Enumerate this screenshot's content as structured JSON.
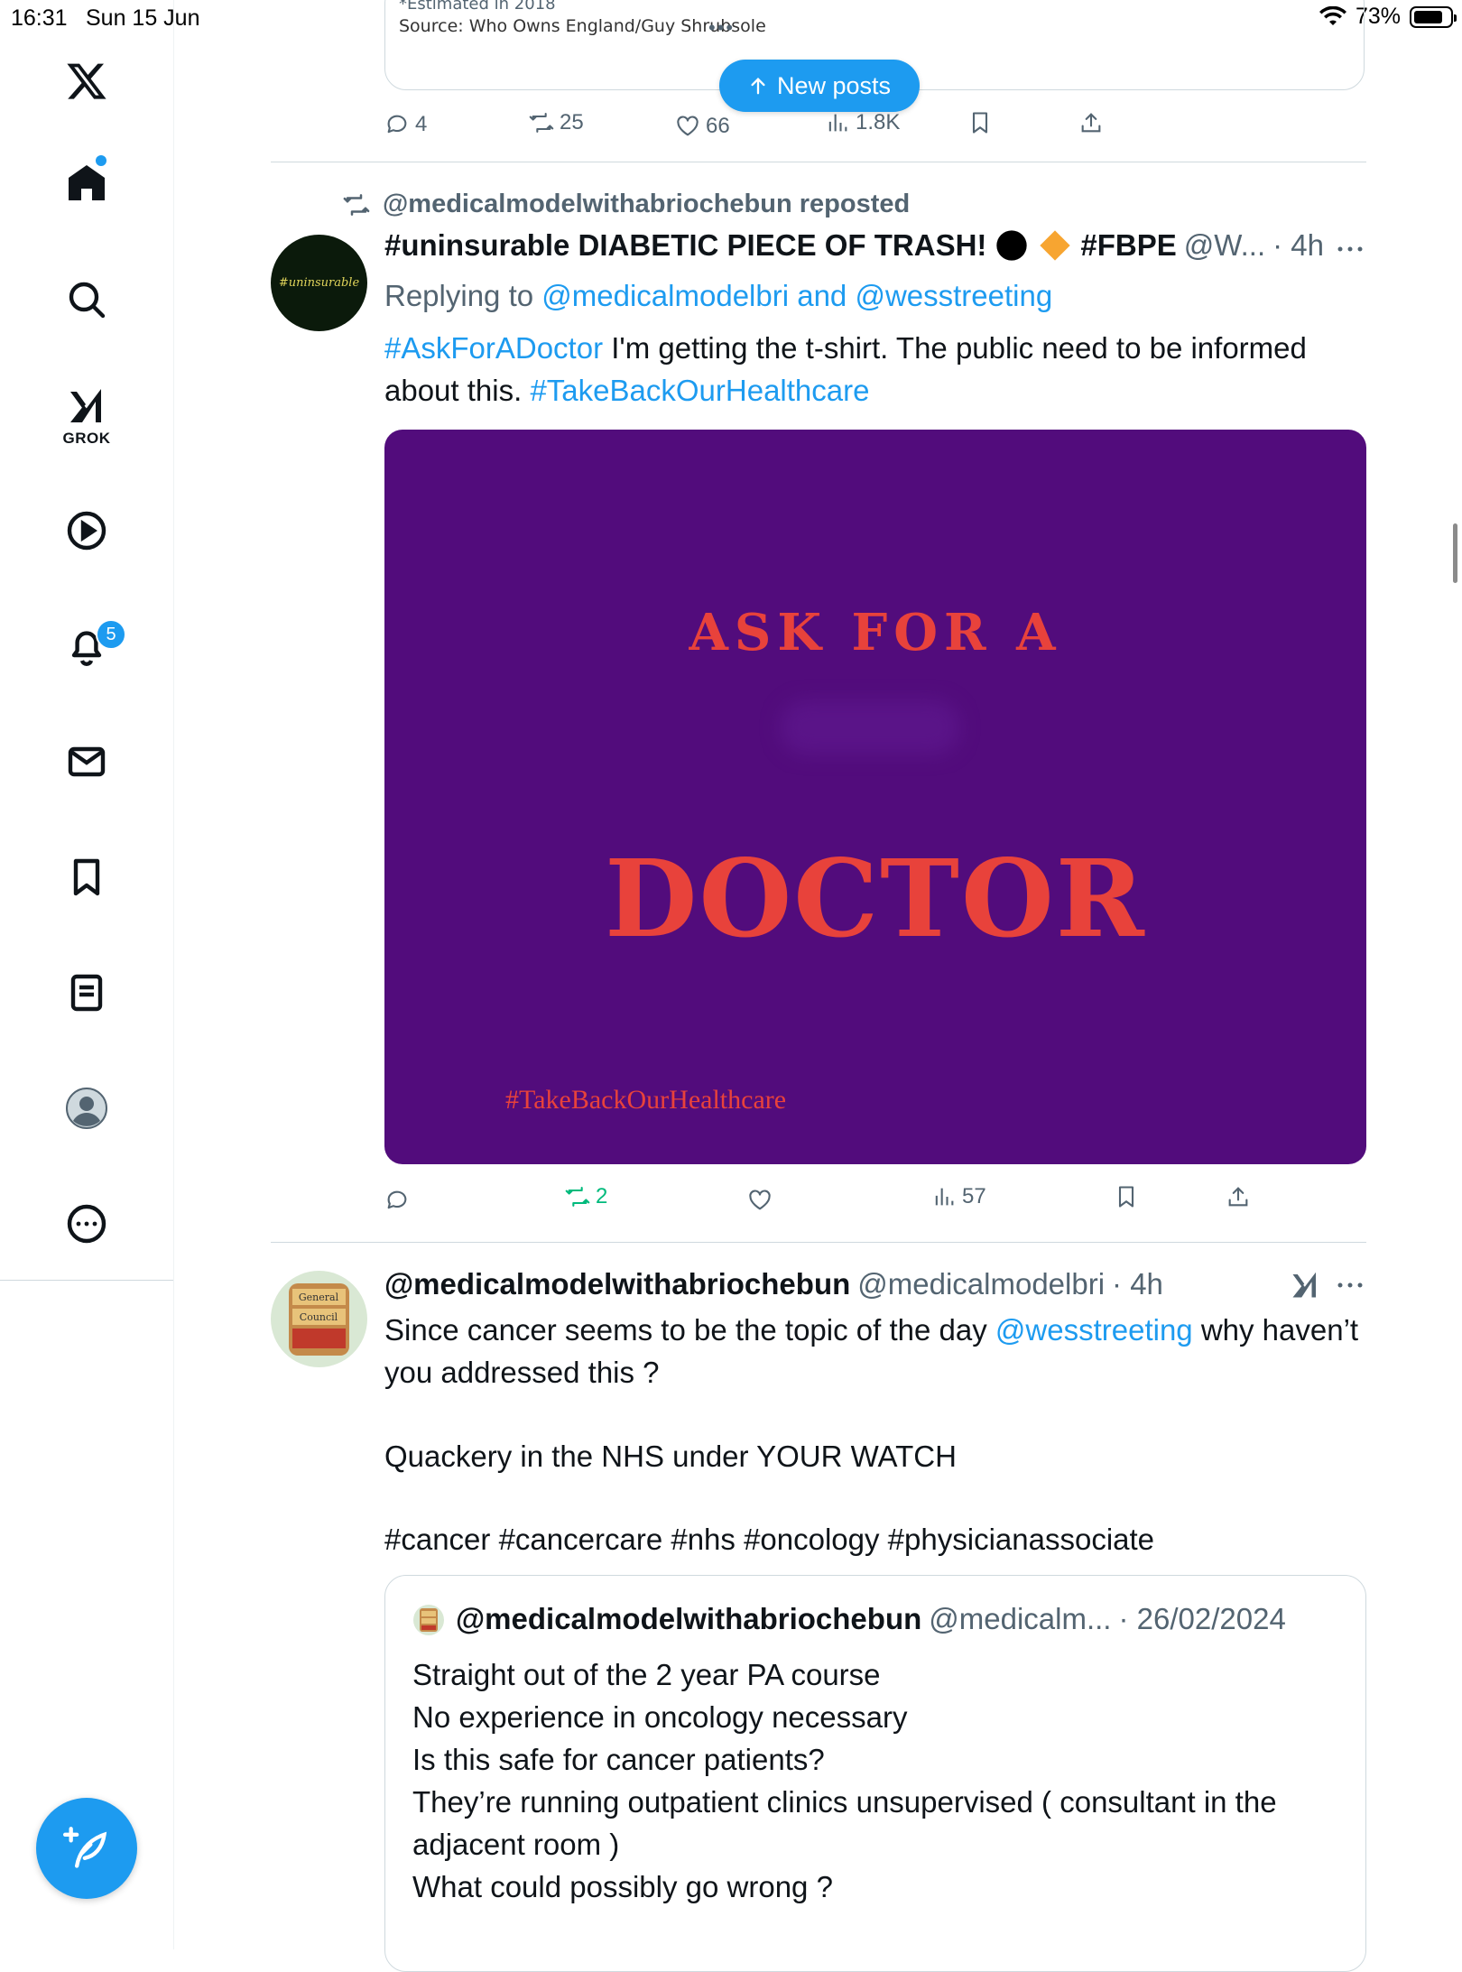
{
  "status_bar": {
    "time": "16:31",
    "date": "Sun 15 Jun",
    "battery": "73%"
  },
  "sidebar": {
    "notifications_count": "5",
    "grok_label": "GROK",
    "items": [
      "x-logo",
      "home",
      "search",
      "grok",
      "videos",
      "notifications",
      "messages",
      "bookmarks",
      "lists",
      "profile",
      "more"
    ]
  },
  "top_card": {
    "note": "*Estimated in 2018",
    "source": "Source: Who Owns England/Guy Shrubsole",
    "replies": "4",
    "reposts": "25",
    "likes": "66",
    "views": "1.8K"
  },
  "new_posts": {
    "label": "New posts"
  },
  "post1": {
    "repost_text": "@medicalmodelwithabriochebun reposted",
    "avatar_text": "#uninsurable",
    "name": "#uninsurable DIABETIC PIECE OF TRASH!",
    "name_suffix": "#FBPE",
    "handle": "@W...",
    "time": "· 4h",
    "replying_prefix": "Replying to",
    "replying_to": "@medicalmodelbri and @wesstreeting",
    "hashtag1": "#AskForADoctor",
    "text1": " I'm getting the t-shirt. The public need to be informed about this. ",
    "hashtag2": "#TakeBackOurHealthcare",
    "media": {
      "line1": "ASK  FOR  A",
      "line2": "DOCTOR",
      "tag": "#TakeBackOurHealthcare"
    },
    "reposts": "2",
    "views": "57"
  },
  "post2": {
    "name": "@medicalmodelwithabriochebun",
    "handle": "@medicalmodelbri",
    "time": "· 4h",
    "text_a": "Since cancer seems to be the topic of the day ",
    "mention": "@wesstreeting",
    "text_b": " why haven’t you addressed this ?",
    "text_c": "Quackery in the NHS under YOUR WATCH",
    "hashtags": "#cancer #cancercare #nhs #oncology #physicianassociate",
    "quote": {
      "name": "@medicalmodelwithabriochebun",
      "handle": "@medicalm...",
      "date": "· 26/02/2024",
      "lines": [
        "Straight  out of the 2 year PA course",
        "No experience in oncology necessary",
        "Is this safe for cancer patients?",
        "They’re running outpatient clinics unsupervised ( consultant in the adjacent room )",
        "What could possibly go wrong ?"
      ]
    }
  }
}
